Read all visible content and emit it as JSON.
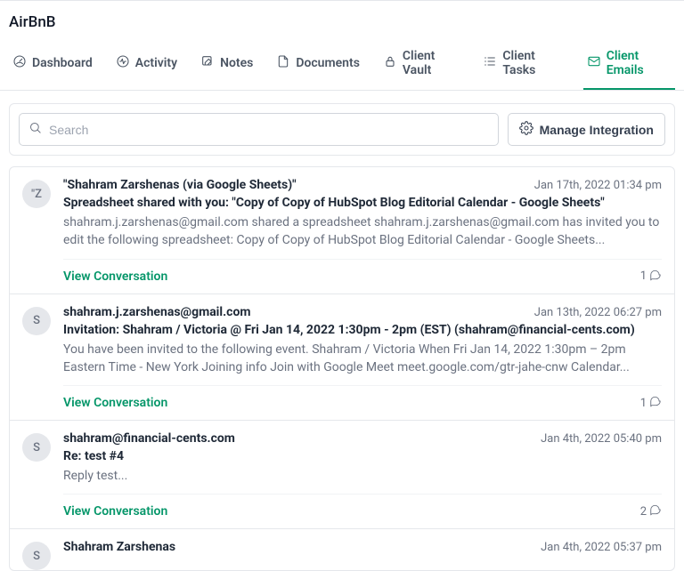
{
  "page": {
    "title": "AirBnB"
  },
  "tabs": [
    {
      "label": "Dashboard"
    },
    {
      "label": "Activity"
    },
    {
      "label": "Notes"
    },
    {
      "label": "Documents"
    },
    {
      "label": "Client Vault"
    },
    {
      "label": "Client Tasks"
    },
    {
      "label": "Client Emails"
    }
  ],
  "search": {
    "placeholder": "Search"
  },
  "manage": {
    "label": "Manage Integration"
  },
  "viewLabel": "View Conversation",
  "emails": [
    {
      "avatar": "\"Z",
      "sender": "\"Shahram Zarshenas (via Google Sheets)\"",
      "timestamp": "Jan 17th, 2022 01:34 pm",
      "subject": "Spreadsheet shared with you: \"Copy of Copy of HubSpot Blog Editorial Calendar - Google Sheets\"",
      "preview": "shahram.j.zarshenas@gmail.com shared a spreadsheet shahram.j.zarshenas@gmail.com has invited you to edit the following spreadsheet: Copy of Copy of HubSpot Blog Editorial Calendar - Google Sheets...",
      "count": "1"
    },
    {
      "avatar": "S",
      "sender": "shahram.j.zarshenas@gmail.com",
      "timestamp": "Jan 13th, 2022 06:27 pm",
      "subject": "Invitation: Shahram / Victoria @ Fri Jan 14, 2022 1:30pm - 2pm (EST) (shahram@financial-cents.com)",
      "preview": "You have been invited to the following event. Shahram / Victoria When Fri Jan 14, 2022 1:30pm – 2pm Eastern Time - New York Joining info Join with Google Meet meet.google.com/gtr-jahe-cnw Calendar...",
      "count": "1"
    },
    {
      "avatar": "S",
      "sender": "shahram@financial-cents.com",
      "timestamp": "Jan 4th, 2022 05:40 pm",
      "subject": "Re: test #4",
      "preview": "Reply test...",
      "count": "2"
    },
    {
      "avatar": "S",
      "sender": "Shahram Zarshenas",
      "timestamp": "Jan 4th, 2022 05:37 pm",
      "subject": "",
      "preview": "",
      "count": ""
    }
  ]
}
